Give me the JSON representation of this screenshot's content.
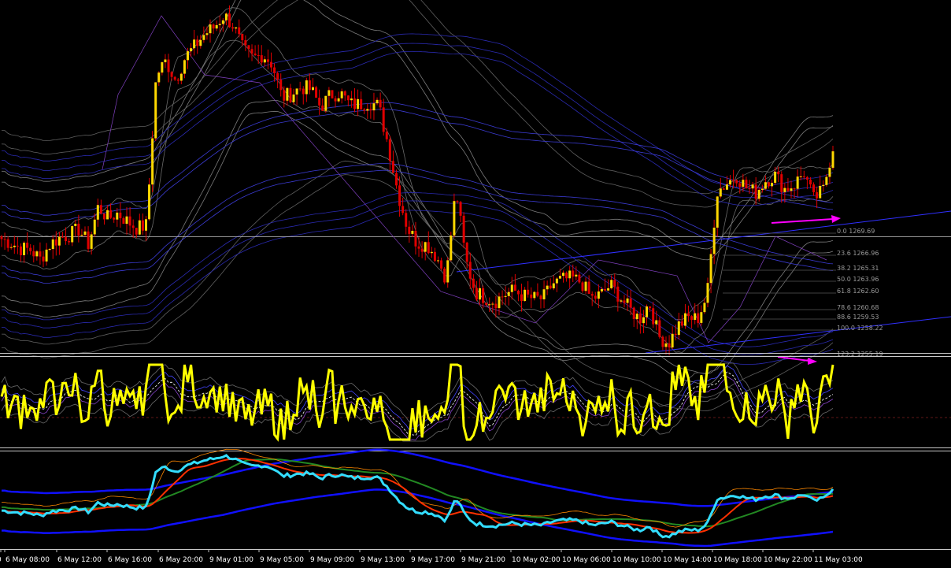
{
  "colors": {
    "background": "#000000",
    "candle_up": "#ffd800",
    "candle_down": "#e00000",
    "wick": "#e00000",
    "fib_text": "#9a9a9a",
    "price_line": "#c8c8c8",
    "trend_line": "#3030ff",
    "divergence_arrow": "#ff00ff",
    "oscillator_main": "#ffff00",
    "oscillator_signal": "#ffffff",
    "lower_main": "#33ddff",
    "lower_band": "#1010ff",
    "lower_ma_red": "#ff3000",
    "lower_ma_green": "#228822",
    "lower_ma_orange": "#ff8800",
    "pane_separator": "#c8c8c8",
    "axis_text": "#ffffff"
  },
  "fib_levels": [
    {
      "label": "0.0 1269.69"
    },
    {
      "label": "23.6 1266.96"
    },
    {
      "label": "38.2 1265.31"
    },
    {
      "label": "50.0 1263.96"
    },
    {
      "label": "61.8 1262.60"
    },
    {
      "label": "78.6 1260.68"
    },
    {
      "label": "88.6 1259.53"
    },
    {
      "label": "100.0 1258.22"
    },
    {
      "label": "123.2 1255.19"
    }
  ],
  "time_axis": {
    "labels": [
      "0",
      "6 May 08:00",
      "6 May 12:00",
      "6 May 16:00",
      "6 May 20:00",
      "9 May 01:00",
      "9 May 05:00",
      "9 May 09:00",
      "9 May 13:00",
      "9 May 17:00",
      "9 May 21:00",
      "10 May 02:00",
      "10 May 06:00",
      "10 May 10:00",
      "10 May 14:00",
      "10 May 18:00",
      "10 May 22:00",
      "11 May 03:00"
    ]
  },
  "chart_data": {
    "type": "candlestick",
    "symbol": "",
    "price_points": [
      1262.9,
      1262.6,
      1262.2,
      1262.1,
      1261.4,
      1262.5,
      1263.0,
      1263.2,
      1263.6,
      1262.5,
      1265.3,
      1264.4,
      1264.8,
      1264.2,
      1263.7,
      1263.9,
      1275.0,
      1276.0,
      1274.6,
      1276.3,
      1277.1,
      1278.0,
      1278.5,
      1279.4,
      1278.6,
      1276.8,
      1276.2,
      1276.5,
      1275.8,
      1273.3,
      1273.6,
      1274.1,
      1273.9,
      1272.6,
      1273.5,
      1273.7,
      1272.8,
      1272.8,
      1273.0,
      1272.7,
      1269.8,
      1266.3,
      1263.7,
      1262.6,
      1262.5,
      1261.6,
      1260.0,
      1266.6,
      1261.4,
      1259.0,
      1258.6,
      1258.3,
      1258.8,
      1259.1,
      1258.7,
      1258.5,
      1258.5,
      1259.6,
      1259.9,
      1260.0,
      1259.7,
      1258.5,
      1258.8,
      1259.5,
      1258.6,
      1257.7,
      1257.0,
      1258.2,
      1255.7,
      1255.2,
      1256.5,
      1257.1,
      1257.0,
      1258.8,
      1266.4,
      1267.0,
      1267.6,
      1266.7,
      1266.3,
      1267.2,
      1267.6,
      1266.6,
      1266.9,
      1267.8,
      1265.8,
      1266.5,
      1269.7
    ],
    "oscillator": {
      "series": [
        "main",
        "signal"
      ]
    },
    "lower_indicator": {
      "series": [
        "main",
        "upper_band",
        "lower_band",
        "ma_red",
        "ma_green",
        "ma_orange"
      ]
    }
  }
}
